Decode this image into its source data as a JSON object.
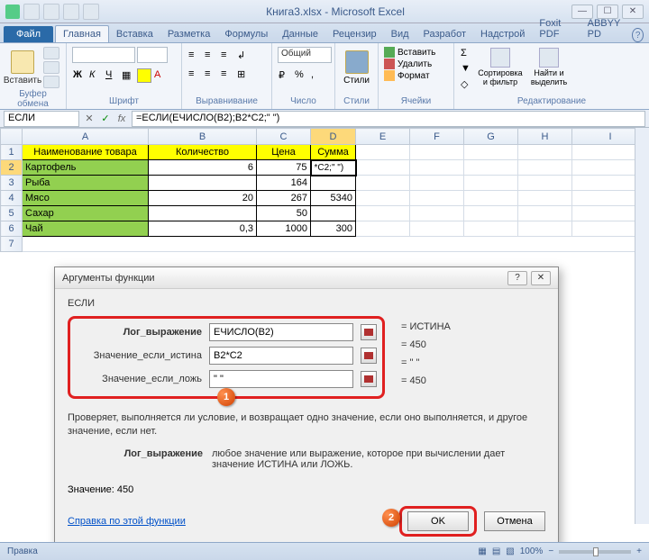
{
  "title": "Книга3.xlsx - Microsoft Excel",
  "tabs": {
    "file": "Файл",
    "list": [
      "Главная",
      "Вставка",
      "Разметка",
      "Формулы",
      "Данные",
      "Рецензир",
      "Вид",
      "Разработ",
      "Надстрой",
      "Foxit PDF",
      "ABBYY PD"
    ]
  },
  "ribbon": {
    "paste": "Вставить",
    "clipboard": "Буфер обмена",
    "font_name": "",
    "font_size": "",
    "font_group": "Шрифт",
    "align_group": "Выравнивание",
    "number_group": "Число",
    "general": "Общий",
    "styles": "Стили",
    "styles_group": "Стили",
    "insert_cell": "Вставить",
    "delete_cell": "Удалить",
    "format_cell": "Формат",
    "cells_group": "Ячейки",
    "sort": "Сортировка и фильтр",
    "find": "Найти и выделить",
    "edit_group": "Редактирование"
  },
  "formula_bar": {
    "name_box": "ЕСЛИ",
    "formula": "=ЕСЛИ(ЕЧИСЛО(B2);B2*C2;\" \")"
  },
  "columns": [
    "A",
    "B",
    "C",
    "D",
    "E",
    "F",
    "G",
    "H",
    "I"
  ],
  "headers": [
    "Наименование товара",
    "Количество",
    "Цена",
    "Сумма"
  ],
  "rows": [
    {
      "n": "2",
      "name": "Картофель",
      "qty": "6",
      "price": "75",
      "sum": "*C2;\" \")"
    },
    {
      "n": "3",
      "name": "Рыба",
      "qty": "",
      "price": "164",
      "sum": ""
    },
    {
      "n": "4",
      "name": "Мясо",
      "qty": "20",
      "price": "267",
      "sum": "5340"
    },
    {
      "n": "5",
      "name": "Сахар",
      "qty": "",
      "price": "50",
      "sum": ""
    },
    {
      "n": "6",
      "name": "Чай",
      "qty": "0,3",
      "price": "1000",
      "sum": "300"
    }
  ],
  "dialog": {
    "title": "Аргументы функции",
    "func": "ЕСЛИ",
    "arg1_label": "Лог_выражение",
    "arg1_value": "ЕЧИСЛО(B2)",
    "arg1_result": "= ИСТИНА",
    "arg2_label": "Значение_если_истина",
    "arg2_value": "B2*C2",
    "arg2_result": "= 450",
    "arg3_label": "Значение_если_ложь",
    "arg3_value": "\" \"",
    "arg3_result": "= \" \"",
    "result_eq": "= 450",
    "desc": "Проверяет, выполняется ли условие, и возвращает одно значение, если оно выполняется, и другое значение, если нет.",
    "hint_label": "Лог_выражение",
    "hint_text": "любое значение или выражение, которое при вычислении дает значение ИСТИНА или ЛОЖЬ.",
    "value_label": "Значение:",
    "value": "450",
    "help": "Справка по этой функции",
    "ok": "OK",
    "cancel": "Отмена",
    "badge1": "1",
    "badge2": "2"
  },
  "status": {
    "mode": "Правка",
    "zoom": "100%"
  }
}
